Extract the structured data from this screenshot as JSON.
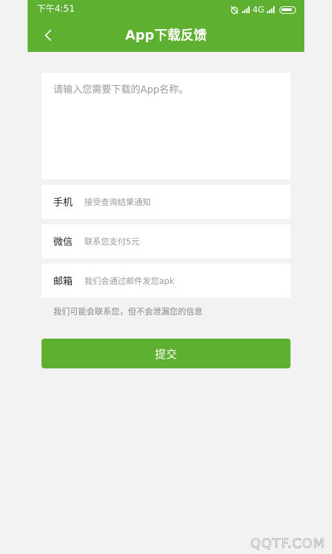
{
  "status_bar": {
    "time": "下午4:51",
    "network": "4G"
  },
  "header": {
    "title": "App下载反馈"
  },
  "form": {
    "app_name_placeholder": "请输入您需要下载的App名称。",
    "phone": {
      "label": "手机",
      "placeholder": "接受查询结果通知"
    },
    "wechat": {
      "label": "微信",
      "placeholder": "联系您支付5元"
    },
    "email": {
      "label": "邮箱",
      "placeholder": "我们会通过邮件发您apk"
    },
    "hint": "我们可能会联系您，但不会泄漏您的信息",
    "submit_label": "提交"
  },
  "watermark": "QQTF.COM",
  "colors": {
    "brand_green": "#5eb030",
    "background": "#f2f2f2"
  }
}
